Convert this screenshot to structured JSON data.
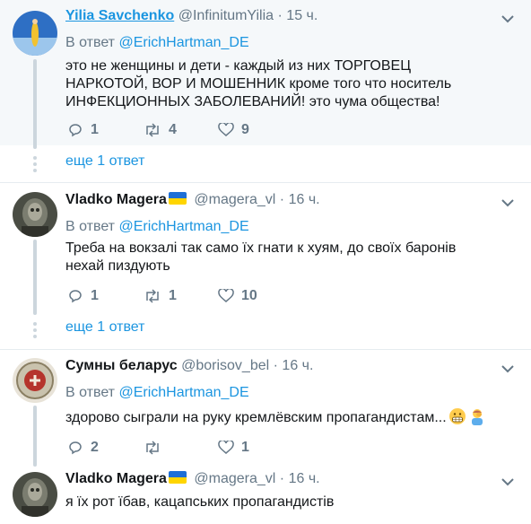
{
  "replies": [
    {
      "name": "Yilia Savchenko",
      "handle": "@InfinitumYilia",
      "time": "15 ч.",
      "reply_prefix": "В ответ",
      "reply_mention": "@ErichHartman_DE",
      "text": "это не женщины и дети - каждый из них ТОРГОВЕЦ НАРКОТОЙ, ВОР И МОШЕННИК кроме того что носитель ИНФЕКЦИОННЫХ ЗАБОЛЕВАНИЙ! это чума общества!",
      "replies_count": "1",
      "retweets_count": "4",
      "likes_count": "9",
      "more": "еще 1 ответ"
    },
    {
      "name": "Vladko Magera",
      "handle": "@magera_vl",
      "time": "16 ч.",
      "reply_prefix": "В ответ",
      "reply_mention": "@ErichHartman_DE",
      "text": "Треба на вокзалі так само їх гнати к хуям, до своїх баронів нехай пиздують",
      "replies_count": "1",
      "retweets_count": "1",
      "likes_count": "10",
      "more": "еще 1 ответ"
    },
    {
      "name": "Сумны беларус",
      "handle": "@borisov_bel",
      "time": "16 ч.",
      "reply_prefix": "В ответ",
      "reply_mention": "@ErichHartman_DE",
      "text": "здорово сыграли на руку кремлёвским пропагандистам...",
      "replies_count": "2",
      "retweets_count": "",
      "likes_count": "1"
    },
    {
      "name": "Vladko Magera",
      "handle": "@magera_vl",
      "time": "16 ч.",
      "text": "я їх рот їбав, кацапських пропагандистів"
    }
  ],
  "separator": "·",
  "colors": {
    "link": "#1b95e0",
    "muted": "#657786",
    "highlight_bg": "#f5f8fa"
  }
}
